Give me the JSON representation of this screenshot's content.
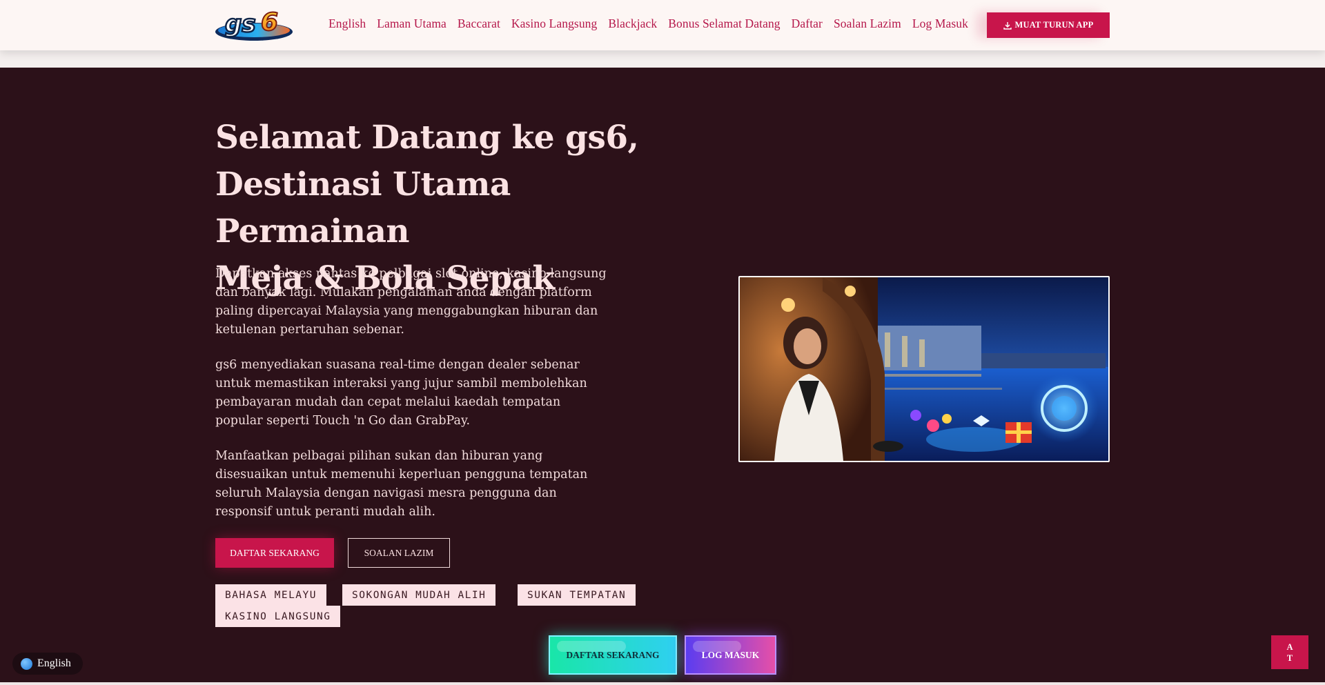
{
  "header": {
    "logo_text": "gs6",
    "nav": [
      "English",
      "Laman Utama",
      "Baccarat",
      "Kasino Langsung",
      "Blackjack",
      "Bonus Selamat Datang",
      "Daftar",
      "Soalan Lazim",
      "Log Masuk"
    ],
    "download_label": "MUAT TURUN APP",
    "download_icon": "download-icon"
  },
  "hero": {
    "title_line1": "Selamat Datang ke gs6,",
    "title_line2": "Destinasi Utama Permainan",
    "title_line3": "Meja & Bola Sepak",
    "para1": "Dapatkan akses pantas ke pelbagai slot online, kasino langsung dan banyak lagi. Mulakan pengalaman anda dengan platform paling dipercayai Malaysia yang menggabungkan hiburan dan ketulenan pertaruhan sebenar.",
    "para2": "gs6 menyediakan suasana real-time dengan dealer sebenar untuk memastikan interaksi yang jujur sambil membolehkan pembayaran mudah dan cepat melalui kaedah tempatan popular seperti Touch 'n Go dan GrabPay.",
    "para3": "Manfaatkan pelbagai pilihan sukan dan hiburan yang disesuaikan untuk memenuhi keperluan pengguna tempatan seluruh Malaysia dengan navigasi mesra pengguna dan responsif untuk peranti mudah alih.",
    "primary_button": "DAFTAR SEKARANG",
    "secondary_button": "SOALAN LAZIM",
    "tags": [
      "BAHASA MELAYU",
      "SOKONGAN MUDAH ALIH",
      "SUKAN TEMPATAN",
      "KASINO LANGSUNG"
    ]
  },
  "floating": {
    "register_label": "DAFTAR SEKARANG",
    "login_label": "LOG MASUK",
    "language_label": "English",
    "back_to_top_line1": "A",
    "back_to_top_line2": "T"
  },
  "colors": {
    "accent": "#c8154b",
    "hero_bg": "#2c1119",
    "header_bg": "#fdf6f4",
    "nav_text": "#b5174a",
    "title_text": "#fbe2e3"
  }
}
